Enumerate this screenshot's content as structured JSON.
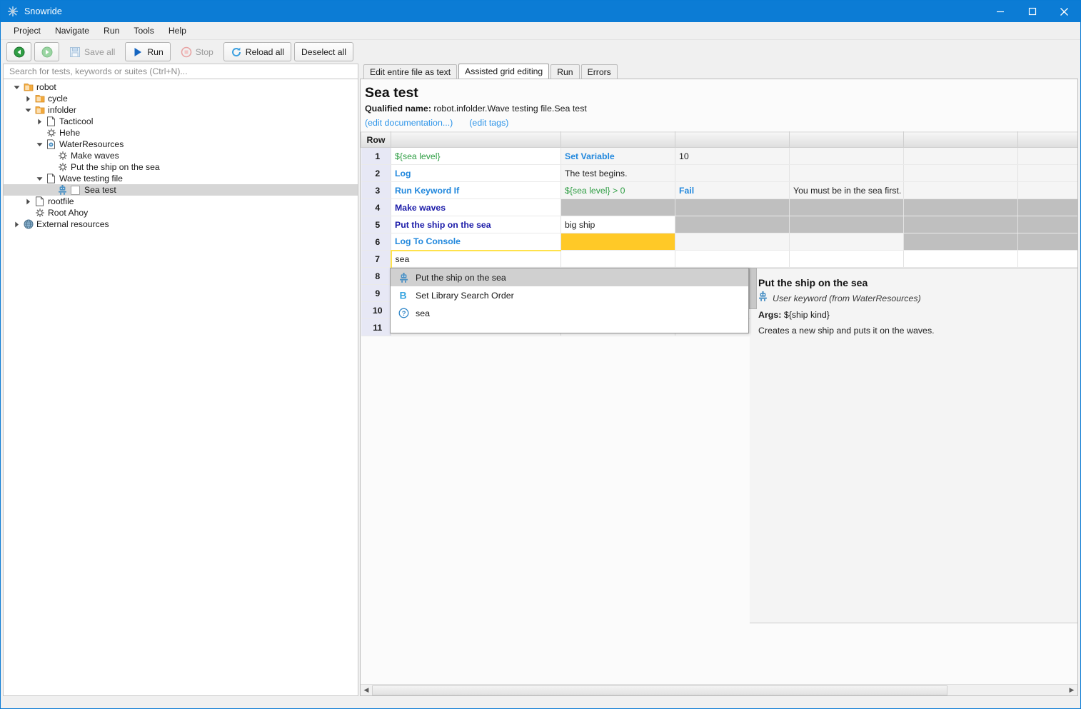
{
  "window": {
    "title": "Snowride",
    "app_icon": "snowflake-icon",
    "minimize_label": "Minimize",
    "maximize_label": "Maximize",
    "close_label": "Close"
  },
  "menubar": {
    "items": [
      {
        "label": "Project"
      },
      {
        "label": "Navigate"
      },
      {
        "label": "Run"
      },
      {
        "label": "Tools"
      },
      {
        "label": "Help"
      }
    ]
  },
  "toolbar": {
    "back_label": "",
    "forward_label": "",
    "save_all_label": "Save all",
    "run_label": "Run",
    "stop_label": "Stop",
    "reload_all_label": "Reload all",
    "deselect_all_label": "Deselect all"
  },
  "search": {
    "placeholder": "Search for tests, keywords or suites (Ctrl+N)...",
    "value": ""
  },
  "tree": {
    "nodes": [
      {
        "label": "robot",
        "indent": 0,
        "twisty": "down",
        "icon": "suite-folder-icon",
        "selected": false,
        "checkbox": false
      },
      {
        "label": "cycle",
        "indent": 1,
        "twisty": "right",
        "icon": "suite-folder-icon",
        "selected": false,
        "checkbox": false
      },
      {
        "label": "infolder",
        "indent": 1,
        "twisty": "down",
        "icon": "suite-folder-icon",
        "selected": false,
        "checkbox": false
      },
      {
        "label": "Tacticool",
        "indent": 2,
        "twisty": "right",
        "icon": "file-icon",
        "selected": false,
        "checkbox": false
      },
      {
        "label": "Hehe",
        "indent": 2,
        "twisty": "none",
        "icon": "keyword-gear-icon",
        "selected": false,
        "checkbox": false
      },
      {
        "label": "WaterResources",
        "indent": 2,
        "twisty": "down",
        "icon": "resource-file-icon",
        "selected": false,
        "checkbox": false
      },
      {
        "label": "Make waves",
        "indent": 3,
        "twisty": "none",
        "icon": "keyword-gear-icon",
        "selected": false,
        "checkbox": false
      },
      {
        "label": "Put the ship on the sea",
        "indent": 3,
        "twisty": "none",
        "icon": "keyword-gear-icon",
        "selected": false,
        "checkbox": false
      },
      {
        "label": "Wave testing file",
        "indent": 2,
        "twisty": "down",
        "icon": "file-icon",
        "selected": false,
        "checkbox": false
      },
      {
        "label": "Sea test",
        "indent": 3,
        "twisty": "none",
        "icon": "test-robot-icon",
        "selected": true,
        "checkbox": true
      },
      {
        "label": "rootfile",
        "indent": 1,
        "twisty": "right",
        "icon": "file-icon",
        "selected": false,
        "checkbox": false
      },
      {
        "label": "Root Ahoy",
        "indent": 1,
        "twisty": "none",
        "icon": "keyword-gear-icon",
        "selected": false,
        "checkbox": false
      },
      {
        "label": "External resources",
        "indent": 0,
        "twisty": "right",
        "icon": "globe-icon",
        "selected": false,
        "checkbox": false
      }
    ]
  },
  "tabs": [
    {
      "label": "Edit entire file as text",
      "active": false
    },
    {
      "label": "Assisted grid editing",
      "active": true
    },
    {
      "label": "Run",
      "active": false
    },
    {
      "label": "Errors",
      "active": false
    }
  ],
  "testdoc": {
    "title": "Sea test",
    "qualified_label": "Qualified name:",
    "qualified_value": "robot.infolder.Wave testing file.Sea test",
    "edit_documentation_link": "(edit documentation...)",
    "edit_tags_link": "(edit tags)"
  },
  "grid": {
    "row_header": "Row",
    "columns": [
      "Row",
      "",
      "",
      "",
      "",
      "",
      ""
    ],
    "rows": [
      {
        "num": "1",
        "cells": [
          {
            "text": "${sea level}",
            "style": "var-green",
            "bg": "white"
          },
          {
            "text": "Set Variable",
            "style": "kw-blue",
            "bg": "alt"
          },
          {
            "text": "10",
            "style": "plain",
            "bg": "alt"
          },
          {
            "text": "",
            "style": "plain",
            "bg": "alt"
          },
          {
            "text": "",
            "style": "plain",
            "bg": "alt"
          },
          {
            "text": "",
            "style": "plain",
            "bg": "alt"
          }
        ]
      },
      {
        "num": "2",
        "cells": [
          {
            "text": "Log",
            "style": "kw-blue",
            "bg": "white"
          },
          {
            "text": "The test begins.",
            "style": "plain",
            "bg": "alt"
          },
          {
            "text": "",
            "style": "plain",
            "bg": "alt"
          },
          {
            "text": "",
            "style": "plain",
            "bg": "alt"
          },
          {
            "text": "",
            "style": "plain",
            "bg": "alt"
          },
          {
            "text": "",
            "style": "plain",
            "bg": "alt"
          }
        ]
      },
      {
        "num": "3",
        "cells": [
          {
            "text": "Run Keyword If",
            "style": "kw-blue",
            "bg": "white"
          },
          {
            "text": "${sea level} > 0",
            "style": "var-green",
            "bg": "alt"
          },
          {
            "text": "Fail",
            "style": "kw-blue",
            "bg": "alt"
          },
          {
            "text": "You must be in the sea first.",
            "style": "plain",
            "bg": "alt"
          },
          {
            "text": "",
            "style": "plain",
            "bg": "alt"
          },
          {
            "text": "",
            "style": "plain",
            "bg": "alt"
          }
        ]
      },
      {
        "num": "4",
        "cells": [
          {
            "text": "Make waves",
            "style": "kw-navy",
            "bg": "white"
          },
          {
            "text": "",
            "style": "plain",
            "bg": "grey"
          },
          {
            "text": "",
            "style": "plain",
            "bg": "grey"
          },
          {
            "text": "",
            "style": "plain",
            "bg": "grey"
          },
          {
            "text": "",
            "style": "plain",
            "bg": "grey"
          },
          {
            "text": "",
            "style": "plain",
            "bg": "grey"
          }
        ]
      },
      {
        "num": "5",
        "cells": [
          {
            "text": "Put the ship on the sea",
            "style": "kw-navy",
            "bg": "white"
          },
          {
            "text": "big ship",
            "style": "plain",
            "bg": "white"
          },
          {
            "text": "",
            "style": "plain",
            "bg": "grey"
          },
          {
            "text": "",
            "style": "plain",
            "bg": "grey"
          },
          {
            "text": "",
            "style": "plain",
            "bg": "grey"
          },
          {
            "text": "",
            "style": "plain",
            "bg": "grey"
          }
        ]
      },
      {
        "num": "6",
        "cells": [
          {
            "text": "Log To Console",
            "style": "kw-blue",
            "bg": "white"
          },
          {
            "text": "",
            "style": "plain",
            "bg": "yellow"
          },
          {
            "text": "",
            "style": "plain",
            "bg": "alt"
          },
          {
            "text": "",
            "style": "plain",
            "bg": "alt"
          },
          {
            "text": "",
            "style": "plain",
            "bg": "grey"
          },
          {
            "text": "",
            "style": "plain",
            "bg": "grey"
          }
        ]
      },
      {
        "num": "7",
        "editing_value": "sea",
        "cells": [
          {
            "text": "sea",
            "style": "plain",
            "bg": "editing"
          },
          {
            "text": "",
            "style": "plain",
            "bg": "white"
          },
          {
            "text": "",
            "style": "plain",
            "bg": "white"
          },
          {
            "text": "",
            "style": "plain",
            "bg": "white"
          },
          {
            "text": "",
            "style": "plain",
            "bg": "white"
          },
          {
            "text": "",
            "style": "plain",
            "bg": "white"
          }
        ]
      },
      {
        "num": "8",
        "cells": [
          {
            "text": "",
            "style": "plain",
            "bg": "white"
          },
          {
            "text": "",
            "style": "plain",
            "bg": "white"
          },
          {
            "text": "",
            "style": "plain",
            "bg": "white"
          },
          {
            "text": "",
            "style": "plain",
            "bg": "white"
          },
          {
            "text": "",
            "style": "plain",
            "bg": "white"
          },
          {
            "text": "",
            "style": "plain",
            "bg": "white"
          }
        ]
      },
      {
        "num": "9",
        "cells": [
          {
            "text": "",
            "style": "plain",
            "bg": "white"
          },
          {
            "text": "",
            "style": "plain",
            "bg": "white"
          },
          {
            "text": "",
            "style": "plain",
            "bg": "white"
          },
          {
            "text": "",
            "style": "plain",
            "bg": "white"
          },
          {
            "text": "",
            "style": "plain",
            "bg": "white"
          },
          {
            "text": "",
            "style": "plain",
            "bg": "white"
          }
        ]
      },
      {
        "num": "10",
        "cells": [
          {
            "text": "",
            "style": "plain",
            "bg": "white"
          },
          {
            "text": "",
            "style": "plain",
            "bg": "white"
          },
          {
            "text": "",
            "style": "plain",
            "bg": "white"
          },
          {
            "text": "",
            "style": "plain",
            "bg": "white"
          },
          {
            "text": "",
            "style": "plain",
            "bg": "white"
          },
          {
            "text": "",
            "style": "plain",
            "bg": "white"
          }
        ]
      },
      {
        "num": "11",
        "cells": [
          {
            "text": "",
            "style": "plain",
            "bg": "white"
          },
          {
            "text": "",
            "style": "plain",
            "bg": "white"
          },
          {
            "text": "",
            "style": "plain",
            "bg": "white"
          },
          {
            "text": "",
            "style": "plain",
            "bg": "white"
          },
          {
            "text": "",
            "style": "plain",
            "bg": "white"
          },
          {
            "text": "",
            "style": "plain",
            "bg": "white"
          }
        ]
      }
    ]
  },
  "autocomplete": {
    "items": [
      {
        "label": "Put the ship on the sea",
        "icon": "test-robot-icon",
        "selected": true
      },
      {
        "label": "Set Library Search Order",
        "icon": "builtin-b-icon",
        "selected": false
      },
      {
        "label": "sea",
        "icon": "unknown-question-icon",
        "selected": false
      }
    ]
  },
  "keyword_doc": {
    "title": "Put the ship on the sea",
    "icon": "test-robot-icon",
    "kind": "User keyword (from WaterResources)",
    "args_label": "Args:",
    "args_value": "${ship kind}",
    "description": "Creates a new ship and puts it on the waves."
  },
  "statusbar": {
    "text": ""
  },
  "colors": {
    "titlebar": "#0c7cd5",
    "accent_link": "#2d94e8",
    "keyword_blue": "#2288dd",
    "user_keyword_navy": "#1a1aa8",
    "variable_green": "#2f9e44",
    "cell_highlight_yellow": "#ffc927",
    "cell_disabled_grey": "#bfbfbf",
    "rownum_bg": "#e7e8f5",
    "selection_grey": "#d6d6d6"
  }
}
